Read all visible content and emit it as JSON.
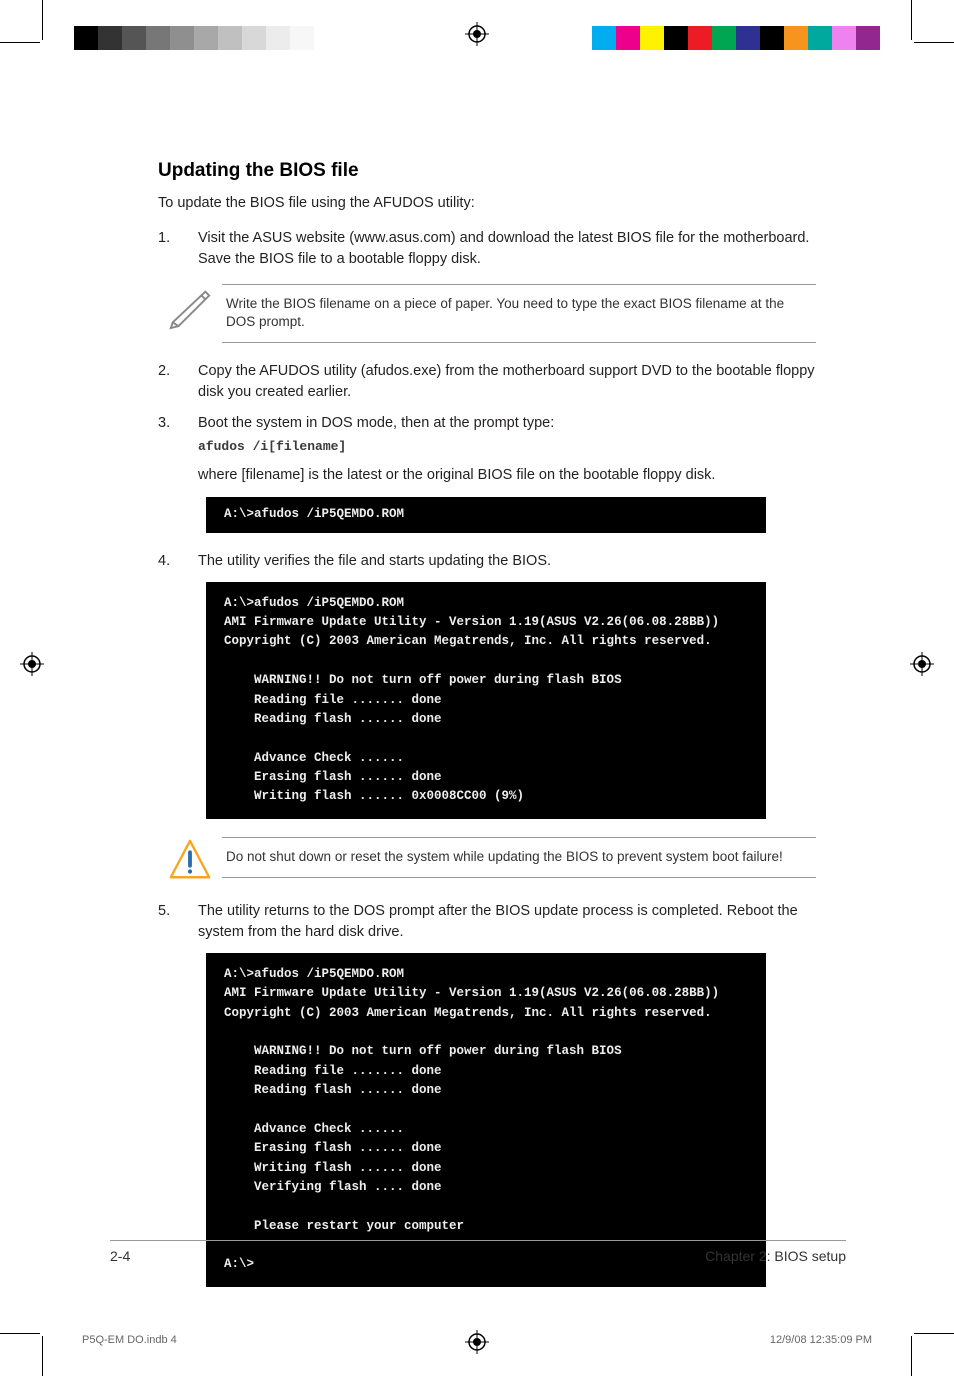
{
  "meta": {
    "slug_left": "P5Q-EM DO.indb   4",
    "slug_right": "12/9/08   12:35:09 PM"
  },
  "colors": {
    "left_strip": [
      "#000000",
      "#333333",
      "#555555",
      "#777777",
      "#8f8f8f",
      "#a8a8a8",
      "#c0c0c0",
      "#d8d8d8",
      "#ececec",
      "#f7f7f7"
    ],
    "right_strip": [
      "#00aeef",
      "#ec008c",
      "#fff200",
      "#000000",
      "#ed1c24",
      "#00a651",
      "#2e3192",
      "#000000",
      "#f7941d",
      "#00a99d",
      "#ee82ee",
      "#92278f"
    ]
  },
  "heading": "Updating the BIOS file",
  "intro": "To update the BIOS file using the AFUDOS utility:",
  "steps": {
    "s1_num": "1.",
    "s1": "Visit the ASUS website (www.asus.com) and download the latest BIOS file for the motherboard. Save the BIOS file to a bootable floppy disk.",
    "note1": "Write the BIOS filename on a piece of paper. You need to type the exact BIOS filename at the DOS prompt.",
    "s2_num": "2.",
    "s2": "Copy the AFUDOS utility (afudos.exe) from the motherboard support DVD to the bootable floppy disk you created earlier.",
    "s3_num": "3.",
    "s3": "Boot the system in DOS mode, then at the prompt type:",
    "s3_code": "afudos /i[filename]",
    "s3_sub": "where [filename] is the latest or the original BIOS file on the bootable floppy disk.",
    "term1": "A:\\>afudos /iP5QEMDO.ROM",
    "s4_num": "4.",
    "s4": "The utility verifies the file and starts updating the BIOS.",
    "term2": "A:\\>afudos /iP5QEMDO.ROM\nAMI Firmware Update Utility - Version 1.19(ASUS V2.26(06.08.28BB))\nCopyright (C) 2003 American Megatrends, Inc. All rights reserved.\n\n    WARNING!! Do not turn off power during flash BIOS\n    Reading file ....... done\n    Reading flash ...... done\n\n    Advance Check ......\n    Erasing flash ...... done\n    Writing flash ...... 0x0008CC00 (9%)",
    "warn": "Do not shut down or reset the system while updating the BIOS to prevent system boot failure!",
    "s5_num": "5.",
    "s5": "The utility returns to the DOS prompt after the BIOS update process is completed. Reboot the system from the hard disk drive.",
    "term3": "A:\\>afudos /iP5QEMDO.ROM\nAMI Firmware Update Utility - Version 1.19(ASUS V2.26(06.08.28BB))\nCopyright (C) 2003 American Megatrends, Inc. All rights reserved.\n\n    WARNING!! Do not turn off power during flash BIOS\n    Reading file ....... done\n    Reading flash ...... done\n\n    Advance Check ......\n    Erasing flash ...... done\n    Writing flash ...... done\n    Verifying flash .... done\n\n    Please restart your computer\n\nA:\\>"
  },
  "footer": {
    "page_num": "2-4",
    "chapter": "Chapter 2: BIOS setup"
  }
}
